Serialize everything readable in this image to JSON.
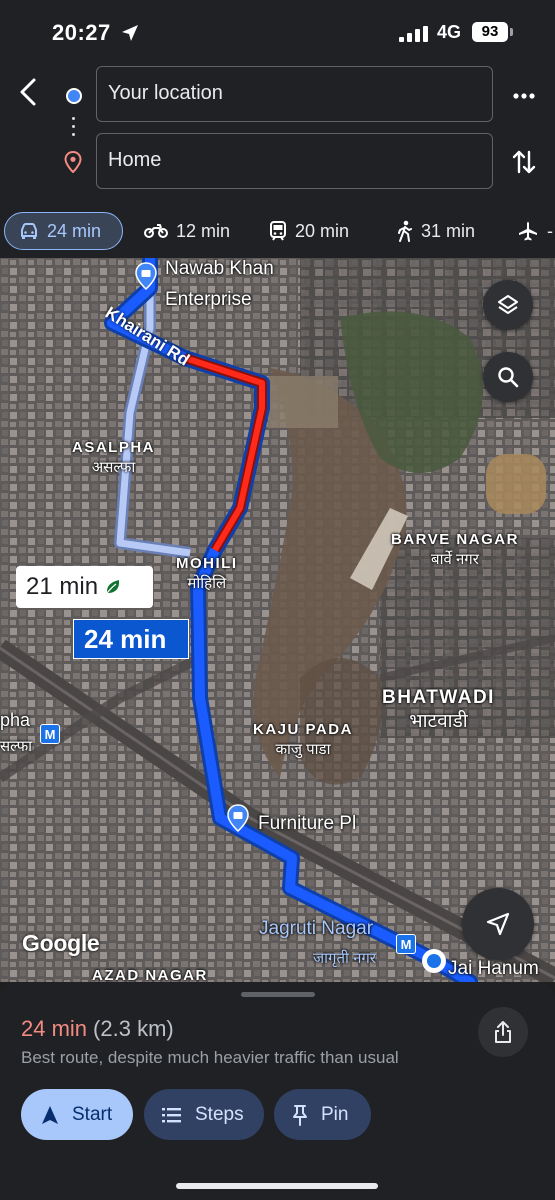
{
  "status_bar": {
    "time": "20:27",
    "network": "4G",
    "battery": "93"
  },
  "directions": {
    "from_value": "Your location",
    "to_value": "Home"
  },
  "modes": [
    {
      "icon": "car-icon",
      "label": "24 min",
      "selected": true
    },
    {
      "icon": "motorbike-icon",
      "label": "12 min"
    },
    {
      "icon": "transit-icon",
      "label": "20 min"
    },
    {
      "icon": "walk-icon",
      "label": "31 min"
    },
    {
      "icon": "flight-icon",
      "label": "-"
    }
  ],
  "map": {
    "places": {
      "nawab_line1": "Nawab Khan",
      "nawab_line2": "Enterprise",
      "furniture": "Furniture Pl",
      "jagruti": "Jagruti Nagar",
      "jagruti_sub": "जागृती नगर",
      "jai": "Jai Hanum",
      "pha": "pha",
      "pha_sub": "सल्फा"
    },
    "areas": {
      "asalpha": "ASALPHA",
      "asalpha_sub": "असल्फा",
      "mohili": "MOHILI",
      "mohili_sub": "मोहिलि",
      "barve": "BARVE NAGAR",
      "barve_sub": "बार्वे नगर",
      "bhatwadi": "BHATWADI",
      "bhatwadi_sub": "भाटवाडी",
      "kaju": "KAJU PADA",
      "kaju_sub": "काजु पाडा",
      "azad": "AZAD NAGAR"
    },
    "street": "Khairani Rd",
    "metro_symbol": "M",
    "alt_route_time": "21 min",
    "main_route_time": "24 min",
    "attribution": "Google",
    "colors": {
      "main_route": "#1a5cff",
      "alt_route": "#b7c9f5",
      "traffic_heavy": "#ff2a1a"
    }
  },
  "sheet": {
    "duration": "24 min",
    "distance": "(2.3 km)",
    "note": "Best route, despite much heavier traffic than usual",
    "start_label": "Start",
    "steps_label": "Steps",
    "pin_label": "Pin"
  }
}
